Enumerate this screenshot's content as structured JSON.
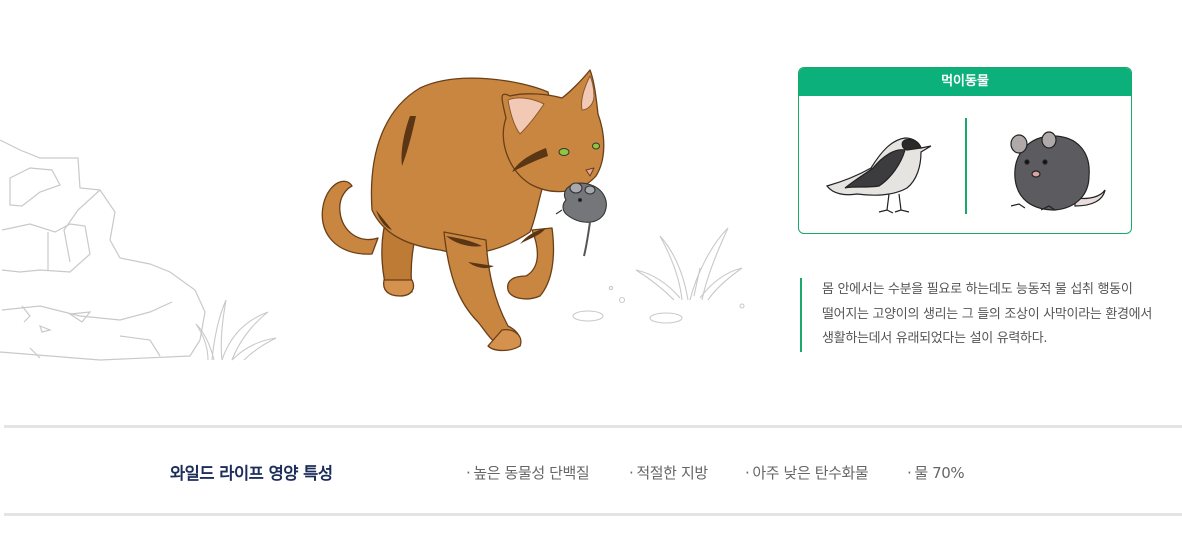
{
  "prey_card": {
    "title": "먹이동물",
    "animals": [
      "bird-illustration",
      "mouse-illustration"
    ]
  },
  "description": {
    "lines": [
      "몸 안에서는 수분을 필요로 하는데도 능동적 물 섭취 행동이",
      "떨어지는 고양이의 생리는 그 들의 조상이 사막이라는 환경에서",
      "생활하는데서 유래되었다는 설이 유력하다."
    ]
  },
  "traits": {
    "title": "와일드 라이프 영양 특성",
    "bullet": "·",
    "items": [
      "높은 동물성 단백질",
      "적절한 지방",
      "아주 낮은 탄수화물",
      "물 70%"
    ]
  },
  "colors": {
    "accent_green": "#0bb07a",
    "cat_orange": "#c98640",
    "title_navy": "#1c2d5a",
    "rule_gray": "#e4e4e4"
  }
}
